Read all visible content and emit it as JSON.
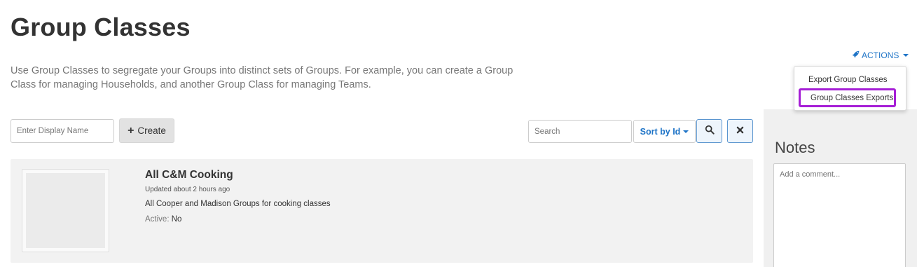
{
  "page": {
    "title": "Group Classes",
    "description": "Use Group Classes to segregate your Groups into distinct sets of Groups. For example, you can create a Group Class for managing Households, and another Group Class for managing Teams."
  },
  "actions": {
    "label": "ACTIONS",
    "icon": "rocket-icon",
    "menu": [
      "Export Group Classes",
      "Group Classes Exports"
    ],
    "highlight_color": "#a61fd6"
  },
  "toolbar": {
    "name_placeholder": "Enter Display Name",
    "create_label": "Create",
    "search_placeholder": "Search",
    "sort_label": "Sort by Id"
  },
  "list": {
    "items": [
      {
        "title": "All C&M Cooking",
        "updated": "Updated about 2 hours ago",
        "description": "All Cooper and Madison Groups for cooking classes",
        "active_label": "Active:",
        "active_value": "No"
      }
    ]
  },
  "notes": {
    "title": "Notes",
    "placeholder": "Add a comment..."
  },
  "colors": {
    "accent": "#1e74c7",
    "card_bg": "#f2f2f2"
  }
}
